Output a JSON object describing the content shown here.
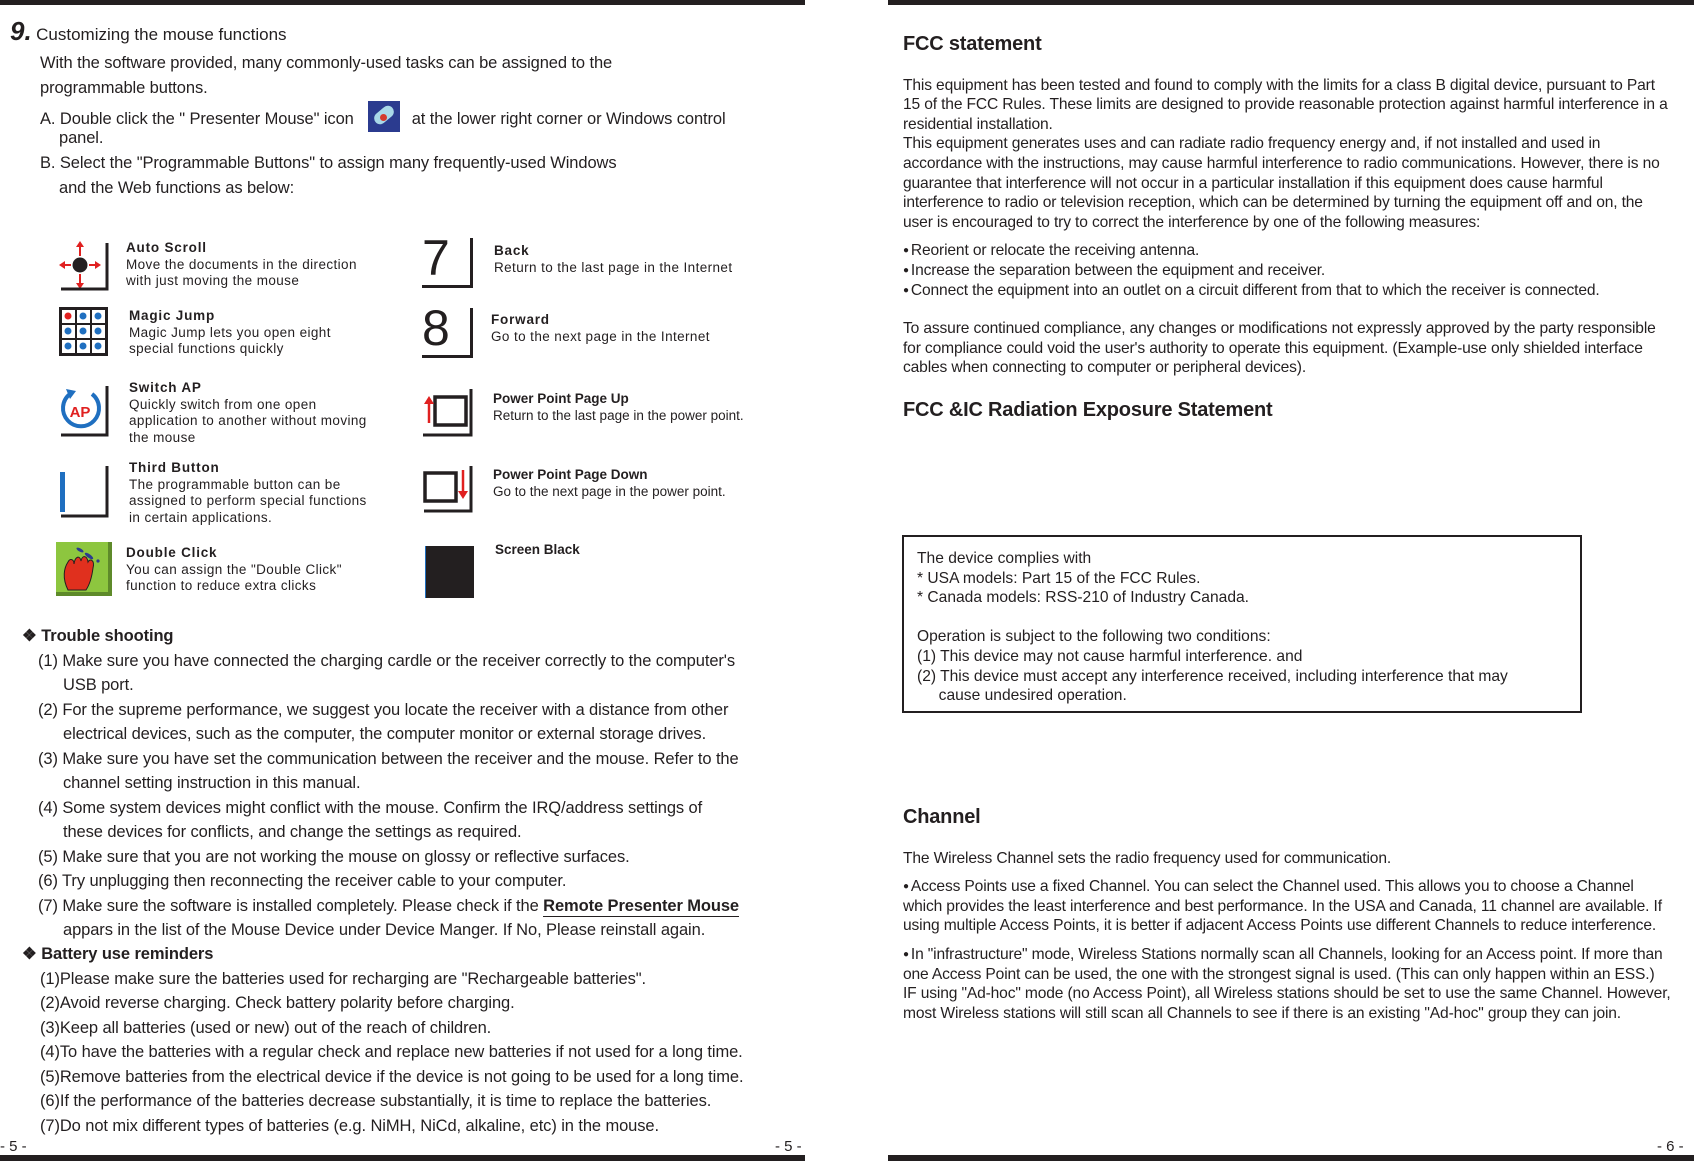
{
  "left_page": {
    "section_number": "9.",
    "section_title": "Customizing the mouse functions",
    "intro": {
      "line1": "With the software provided, many commonly-used tasks can be assigned to the",
      "line2": "programmable buttons.",
      "step_a_prefix": "A. Double click the \" Presenter Mouse\" icon",
      "step_a_icon": "presenter-mouse-icon",
      "step_a_suffix": "at the lower right corner or Windows control",
      "step_a_cont": "panel.",
      "step_b": "B. Select the \"Programmable Buttons\"  to assign many frequently-used Windows",
      "step_b_cont": "and the Web  functions as below:"
    },
    "functions_left": [
      {
        "icon": "auto-scroll-icon",
        "title": "Auto Scroll",
        "lines": [
          "Move the documents in the direction",
          "with  just moving the mouse"
        ]
      },
      {
        "icon": "magic-jump-icon",
        "title": "Magic Jump",
        "lines": [
          "Magic Jump lets you open eight",
          "special functions quickly"
        ]
      },
      {
        "icon": "switch-ap-icon",
        "icon_label": "AP",
        "title": "Switch AP",
        "lines": [
          "Quickly switch from one open",
          "application to another without moving",
          "the mouse"
        ]
      },
      {
        "icon": "third-button-icon",
        "title": "Third Button",
        "lines": [
          "The programmable button can be",
          "assigned to perform special functions",
          "in certain applications."
        ]
      },
      {
        "icon": "double-click-icon",
        "title": "Double Click",
        "lines": [
          "You can assign the \"Double Click\"",
          "function to reduce extra clicks"
        ]
      }
    ],
    "functions_right": [
      {
        "icon": "back-icon",
        "icon_label": "7",
        "title": "Back",
        "lines": [
          "Return to the last page in the Internet"
        ]
      },
      {
        "icon": "forward-icon",
        "icon_label": "8",
        "title": "Forward",
        "lines": [
          "Go to the next page in the Internet"
        ]
      },
      {
        "icon": "page-up-icon",
        "title": "Power Point Page Up",
        "lines": [
          "Return to the last page in the power point."
        ]
      },
      {
        "icon": "page-down-icon",
        "title": "Power Point Page Down",
        "lines": [
          "Go to the next page in the power point."
        ]
      },
      {
        "icon": "screen-black-icon",
        "title": "Screen Black",
        "lines": []
      }
    ],
    "troubleshooting": {
      "title": "Trouble shooting",
      "items": [
        [
          "(1) Make sure you have connected the  charging cardle or the receiver correctly to the computer's",
          "USB port."
        ],
        [
          "(2) For the supreme performance, we suggest you locate the receiver with a distance from other",
          "electrical devices, such as the computer, the computer monitor or external storage drives."
        ],
        [
          "(3) Make sure you have set the communication between the receiver and the mouse. Refer to the",
          "channel setting instruction in this manual."
        ],
        [
          "(4) Some system devices might conflict with the mouse. Confirm the IRQ/address settings of",
          "these devices for conflicts, and change the settings as required."
        ],
        [
          "(5) Make sure that you are not working the mouse on glossy or reflective surfaces."
        ],
        [
          "(6) Try unplugging then reconnecting the receiver cable to your computer."
        ]
      ],
      "item7_prefix": "(7) Make sure the software is installed completely. Please check if the ",
      "item7_link": "Remote Presenter Mouse",
      "item7_cont": "appars in the list of the Mouse Device under Device Manger. If No, Please reinstall again."
    },
    "battery": {
      "title": "Battery use reminders",
      "items": [
        "(1)Please make sure the batteries used for recharging are \"Rechargeable batteries\".",
        "(2)Avoid reverse charging. Check battery polarity before charging.",
        "(3)Keep all batteries (used or new) out of the reach of children.",
        "(4)To have the batteries with a regular check and replace new batteries if not used for a long time.",
        "(5)Remove batteries from the electrical device if the device is not going to be used for a long time.",
        "(6)If the performance of the batteries decrease substantially, it is time to replace the batteries.",
        "(7)Do not mix different types of batteries (e.g. NiMH, NiCd, alkaline, etc) in the mouse."
      ]
    },
    "page_number_left": "- 5 -",
    "page_number_right": "- 5 -"
  },
  "right_page": {
    "fcc_title": "FCC statement",
    "fcc_para1": "This equipment has been tested and found to comply with the limits for a class B digital device, pursuant to Part 15 of the FCC Rules. These limits are designed to provide reasonable protection against harmful interference in a residential installation.",
    "fcc_para2": "This equipment generates uses and can radiate radio frequency energy and, if not installed and used in accordance with the instructions, may cause harmful interference to radio communications. However, there is no guarantee that interference will not occur in a particular installation if this equipment does cause harmful interference to radio or television reception, which can be determined by turning the equipment off and on, the user is encouraged to try to correct the interference by one of the following measures:",
    "measures": [
      "Reorient or relocate the receiving antenna.",
      "Increase the separation between the equipment and receiver.",
      "Connect the equipment into an outlet on a circuit different from that to which the receiver is connected."
    ],
    "compliance_para": "To assure continued compliance, any changes or modifications not expressly approved by the party responsible for compliance could void the user's authority to operate this equipment. (Example-use only shielded interface cables when connecting to computer or peripheral devices).",
    "radiation_title": "FCC &IC Radiation Exposure Statement",
    "box_lines": [
      "The device complies with",
      "* USA models: Part 15 of the FCC Rules.",
      "* Canada models: RSS-210 of Industry Canada.",
      "",
      "Operation is subject to the following two conditions:",
      "(1) This device may not cause harmful interference. and",
      "(2) This device must accept any interference received, including interference that may",
      "     cause undesired operation."
    ],
    "channel_title": "Channel",
    "channel_intro": "The Wireless Channel sets the radio frequency used for communication.",
    "channel_bullet1": "Access Points use a fixed Channel. You can select the Channel used. This allows you to choose a Channel which provides the least interference and best performance. In the USA and Canada, 11 channel are available. If using multiple Access Points, it is better if adjacent Access Points use different Channels to reduce interference.",
    "channel_bullet2": "In \"infrastructure\" mode, Wireless Stations normally scan all Channels, looking for an Access point. If more than one Access Point can be used, the one with the strongest signal is used. (This can only happen within an ESS.)",
    "channel_adhoc": "IF using \"Ad-hoc\" mode (no Access Point), all Wireless stations should be set to use the same Channel. However, most Wireless stations will still scan all Channels to see if there is an existing \"Ad-hoc\" group they can join.",
    "page_number": "- 6 -"
  },
  "colors": {
    "ink": "#231f20",
    "accent_red": "#e02020",
    "accent_blue": "#1f6fc0",
    "icon_green": "#8dc63f"
  }
}
